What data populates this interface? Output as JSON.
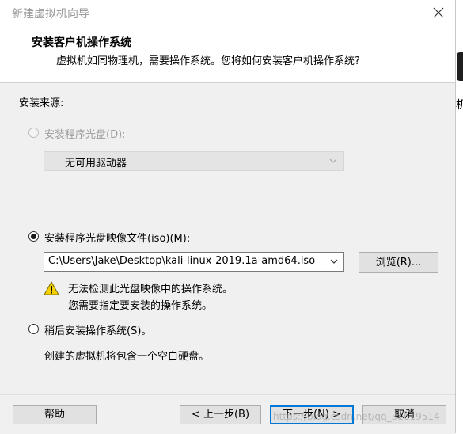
{
  "window": {
    "title": "新建虚拟机向导",
    "close_icon": "close-icon"
  },
  "header": {
    "title": "安装客户机操作系统",
    "subtitle": "虚拟机如同物理机，需要操作系统。您将如何安装客户机操作系统?"
  },
  "source": {
    "label": "安装来源:",
    "disc": {
      "label": "安装程序光盘(D):",
      "selected": false,
      "enabled": false,
      "drive_value": "无可用驱动器"
    },
    "iso": {
      "label": "安装程序光盘映像文件(iso)(M):",
      "selected": true,
      "path": "C:\\Users\\Jake\\Desktop\\kali-linux-2019.1a-amd64.iso",
      "browse_label": "浏览(R)..."
    },
    "warning": {
      "icon": "warning-icon",
      "line1": "无法检测此光盘映像中的操作系统。",
      "line2": "您需要指定要安装的操作系统。"
    },
    "later": {
      "label": "稍后安装操作系统(S)。",
      "selected": false,
      "description": "创建的虚拟机将包含一个空白硬盘。"
    }
  },
  "buttons": {
    "help": "帮助",
    "back": "< 上一步(B)",
    "next": "下一步(N) >",
    "cancel": "取消"
  },
  "background": {
    "edge_text": "机"
  },
  "watermark": "https://blog.csdn.net/qq_31619514"
}
